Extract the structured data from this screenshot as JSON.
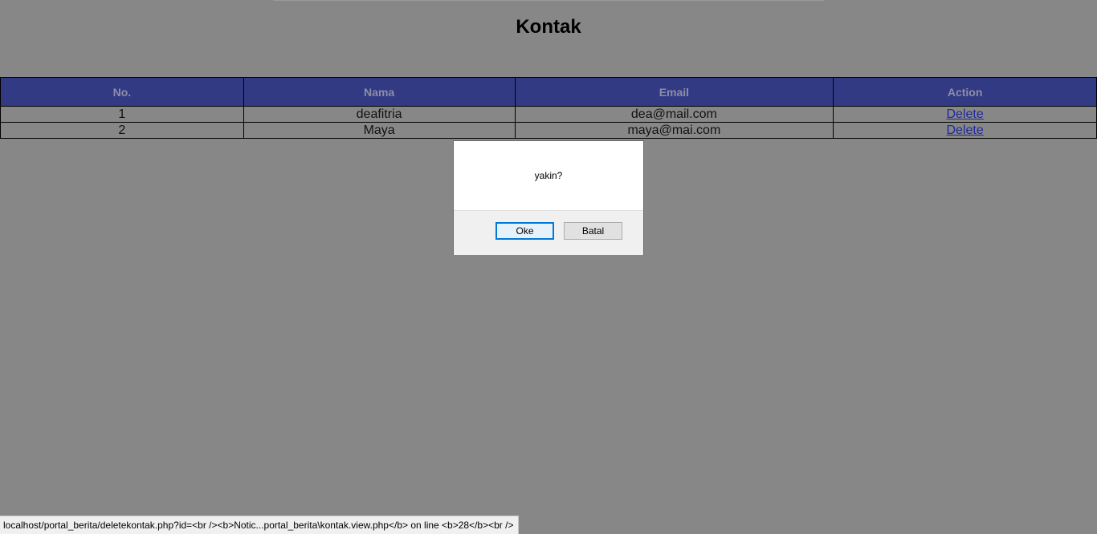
{
  "page": {
    "title": "Kontak"
  },
  "table": {
    "headers": [
      "No.",
      "Nama",
      "Email",
      "Action"
    ],
    "rows": [
      {
        "no": "1",
        "nama": "deafitria",
        "email": "dea@mail.com",
        "action": "Delete"
      },
      {
        "no": "2",
        "nama": "Maya",
        "email": "maya@mai.com",
        "action": "Delete"
      }
    ]
  },
  "dialog": {
    "message": "yakin?",
    "ok_label": "Oke",
    "cancel_label": "Batal"
  },
  "status_bar": {
    "url": "localhost/portal_berita/deletekontak.php?id=<br /><b>Notic...portal_berita\\kontak.view.php</b> on line <b>28</b><br />"
  },
  "colors": {
    "overlay_bg": "#878787",
    "header_bg": "#323a84",
    "link": "#1f2a9a",
    "focus": "#0078d7"
  }
}
